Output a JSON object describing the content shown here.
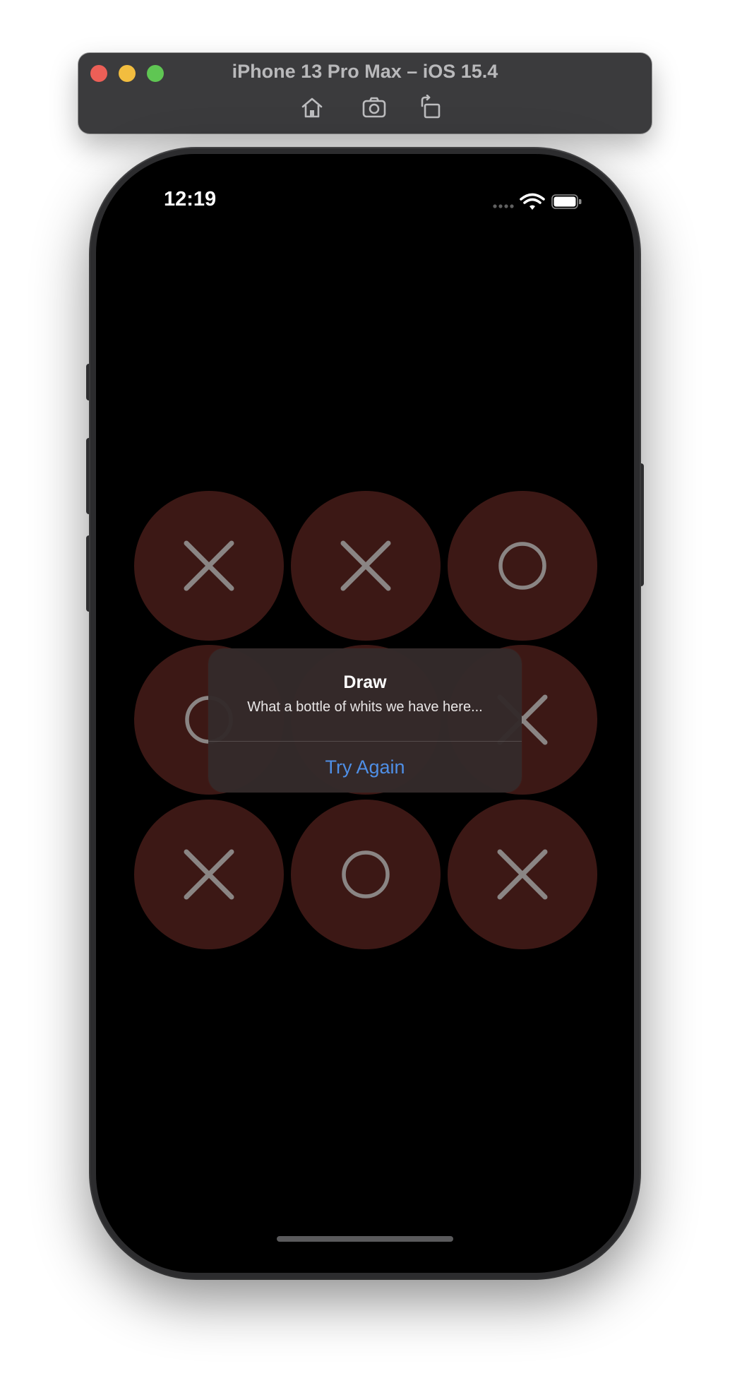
{
  "simulator": {
    "title": "iPhone 13 Pro Max – iOS 15.4",
    "traffic_lights": [
      {
        "name": "close",
        "color": "#ec5f57"
      },
      {
        "name": "minimize",
        "color": "#f2bd3f"
      },
      {
        "name": "zoom",
        "color": "#5fc653"
      }
    ],
    "toolbar_icons": [
      "home-icon",
      "screenshot-icon",
      "rotate-icon"
    ]
  },
  "status_bar": {
    "time": "12:19",
    "icons": [
      "signal-icon",
      "wifi-icon",
      "battery-icon"
    ]
  },
  "board": {
    "cell_color": "#3c1815",
    "mark_color": "#8a8584",
    "cells": [
      "X",
      "X",
      "O",
      "O",
      "",
      "X",
      "X",
      "O",
      "X"
    ]
  },
  "alert": {
    "title": "Draw",
    "message": "What a bottle of whits we have here...",
    "button_label": "Try Again",
    "button_color": "#4f8fe6"
  }
}
